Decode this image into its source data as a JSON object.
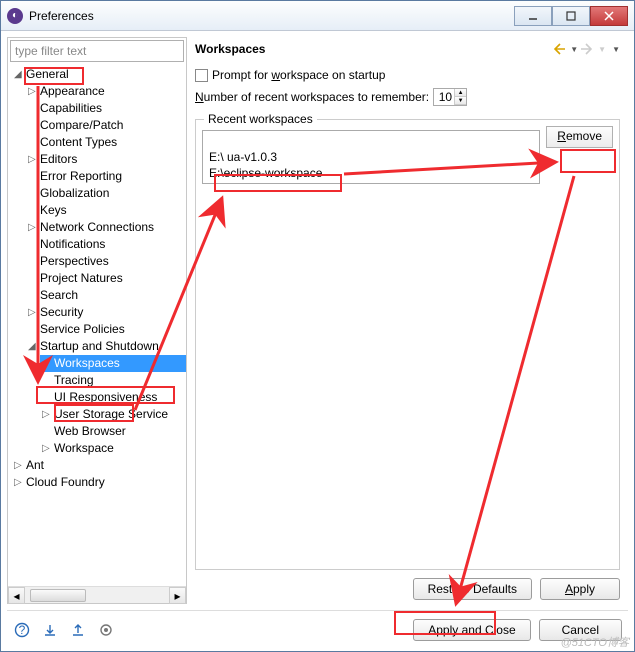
{
  "window": {
    "title": "Preferences"
  },
  "filter": {
    "placeholder": "type filter text"
  },
  "tree": {
    "general": "General",
    "items1": [
      "Appearance",
      "Capabilities",
      "Compare/Patch",
      "Content Types",
      "Editors",
      "Error Reporting",
      "Globalization",
      "Keys",
      "Network Connections",
      "Notifications",
      "Perspectives",
      "Project Natures",
      "Search",
      "Security",
      "Service Policies"
    ],
    "startup": "Startup and Shutdown",
    "workspaces": "Workspaces",
    "items2": [
      "Tracing",
      "UI Responsiveness",
      "User Storage Service",
      "Web Browser",
      "Workspace"
    ],
    "ant": "Ant",
    "cloud": "Cloud Foundry",
    "expandable": {
      "Appearance": true,
      "Editors": true,
      "Network Connections": true,
      "Security": true,
      "User Storage Service": true,
      "Workspace": true
    }
  },
  "page": {
    "title": "Workspaces",
    "prompt_pre": "Prompt for ",
    "prompt_u": "w",
    "prompt_post": "orkspace on startup",
    "number_u": "N",
    "number_post": "umber of recent workspaces to remember:",
    "number_value": "10",
    "recent_label": "Recent workspaces",
    "recent": [
      "",
      "E:\\                                ua-v1.0.3",
      "E:\\eclipse-workspace"
    ],
    "remove_u": "R",
    "remove_post": "emove",
    "restore_pre": "Resto",
    "restore_u": "r",
    "restore_post": "e Defaults",
    "apply_u": "A",
    "apply_post": "pply",
    "applyclose": "Apply and Close",
    "cancel": "Cancel"
  },
  "watermark": "@51CTO博客"
}
